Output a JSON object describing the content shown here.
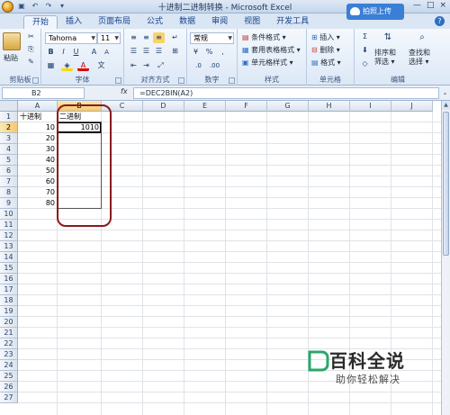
{
  "window": {
    "title": "十进制二进制转换 - Microsoft Excel",
    "controls": [
      "—",
      "□",
      "×"
    ],
    "share_button": "拍照上传"
  },
  "ribbon": {
    "tabs": [
      "开始",
      "插入",
      "页面布局",
      "公式",
      "数据",
      "审阅",
      "视图",
      "开发工具"
    ],
    "active_tab": "开始",
    "groups": {
      "clipboard": {
        "label": "剪贴板",
        "paste": "粘贴"
      },
      "font": {
        "label": "字体",
        "font_name": "Tahoma",
        "font_size": "11"
      },
      "alignment": {
        "label": "对齐方式"
      },
      "number": {
        "label": "数字",
        "format": "常规"
      },
      "styles": {
        "label": "样式",
        "items": [
          "条件格式 ▾",
          "套用表格格式 ▾",
          "单元格样式 ▾"
        ]
      },
      "cells": {
        "label": "单元格",
        "items": [
          "插入 ▾",
          "删除 ▾",
          "格式 ▾"
        ]
      },
      "editing": {
        "label": "编辑",
        "sort_filter": "排序和\n筛选 ▾",
        "find_select": "查找和\n选择 ▾"
      }
    }
  },
  "formula_bar": {
    "name_box": "B2",
    "fx": "fx",
    "formula": "=DEC2BIN(A2)"
  },
  "sheet": {
    "columns": [
      "A",
      "B",
      "C",
      "D",
      "E",
      "F",
      "G",
      "H",
      "I",
      "J"
    ],
    "rows": [
      "1",
      "2",
      "3",
      "4",
      "5",
      "6",
      "7",
      "8",
      "9",
      "10",
      "11",
      "12",
      "13",
      "14",
      "15",
      "16",
      "17",
      "18",
      "19",
      "20",
      "21",
      "22",
      "23",
      "24",
      "25",
      "26",
      "27"
    ],
    "selected_cell": "B2",
    "cells": {
      "A1": "十进制",
      "B1": "二进制",
      "A2": "10",
      "B2": "1010",
      "A3": "20",
      "A4": "30",
      "A5": "40",
      "A6": "50",
      "A7": "60",
      "A8": "70",
      "A9": "80"
    }
  },
  "watermark": {
    "title": "百科全说",
    "subtitle": "助你轻松解决"
  },
  "colors": {
    "accent": "#15428b",
    "annotation": "#8a1a1a",
    "selection_header": "#f7c86a"
  }
}
